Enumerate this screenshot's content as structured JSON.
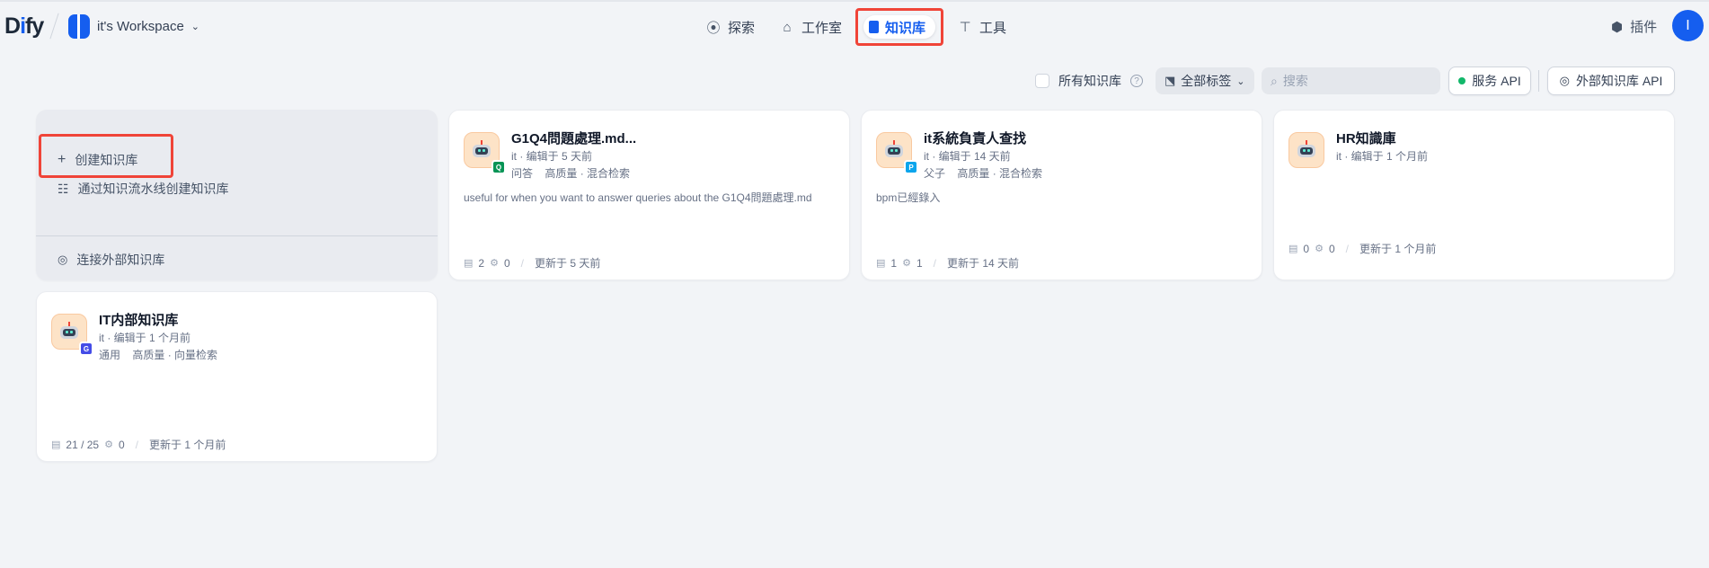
{
  "header": {
    "logo": {
      "prefix": "D",
      "accent": "i",
      "suffix": "fy"
    },
    "workspace": "it's Workspace",
    "nav": [
      {
        "label": "探索",
        "icon": "compass-icon"
      },
      {
        "label": "工作室",
        "icon": "robot-icon"
      },
      {
        "label": "知识库",
        "icon": "book-icon",
        "active": true
      },
      {
        "label": "工具",
        "icon": "hammer-icon"
      }
    ],
    "plugins_label": "插件",
    "avatar_initial": "I"
  },
  "filters": {
    "all_kb_label": "所有知识库",
    "help": "?",
    "tags_label": "全部标签",
    "search_placeholder": "搜索",
    "service_api": "服务 API",
    "external_api": "外部知识库 API"
  },
  "create_card": {
    "create": "创建知识库",
    "pipeline": "通过知识流水线创建知识库",
    "connect": "连接外部知识库"
  },
  "knowledge_bases": [
    {
      "title": "G1Q4問題處理.md...",
      "meta": "it · 编辑于 5 天前",
      "tags": [
        "问答",
        "高质量 · 混合检索"
      ],
      "description": "useful for when you want to answer queries about the G1Q4問題處理.md",
      "docs": "2",
      "apps": "0",
      "updated": "更新于 5 天前",
      "badge_color": "#079455"
    },
    {
      "title": "it系統負責人查找",
      "meta": "it · 编辑于 14 天前",
      "tags": [
        "父子",
        "高质量 · 混合检索"
      ],
      "description": "bpm已經錄入",
      "docs": "1",
      "apps": "1",
      "updated": "更新于 14 天前",
      "badge_color": "#0ba5ec"
    },
    {
      "title": "HR知識庫",
      "meta": "it · 编辑于 1 个月前",
      "tags": [],
      "description": "",
      "docs": "0",
      "apps": "0",
      "updated": "更新于 1 个月前"
    },
    {
      "title": "IT内部知识库",
      "meta": "it · 编辑于 1 个月前",
      "tags": [
        "通用",
        "高质量 · 向量检索"
      ],
      "description": "",
      "docs": "21 / 25",
      "apps": "0",
      "updated": "更新于 1 个月前",
      "badge_color": "#444ce7"
    }
  ]
}
